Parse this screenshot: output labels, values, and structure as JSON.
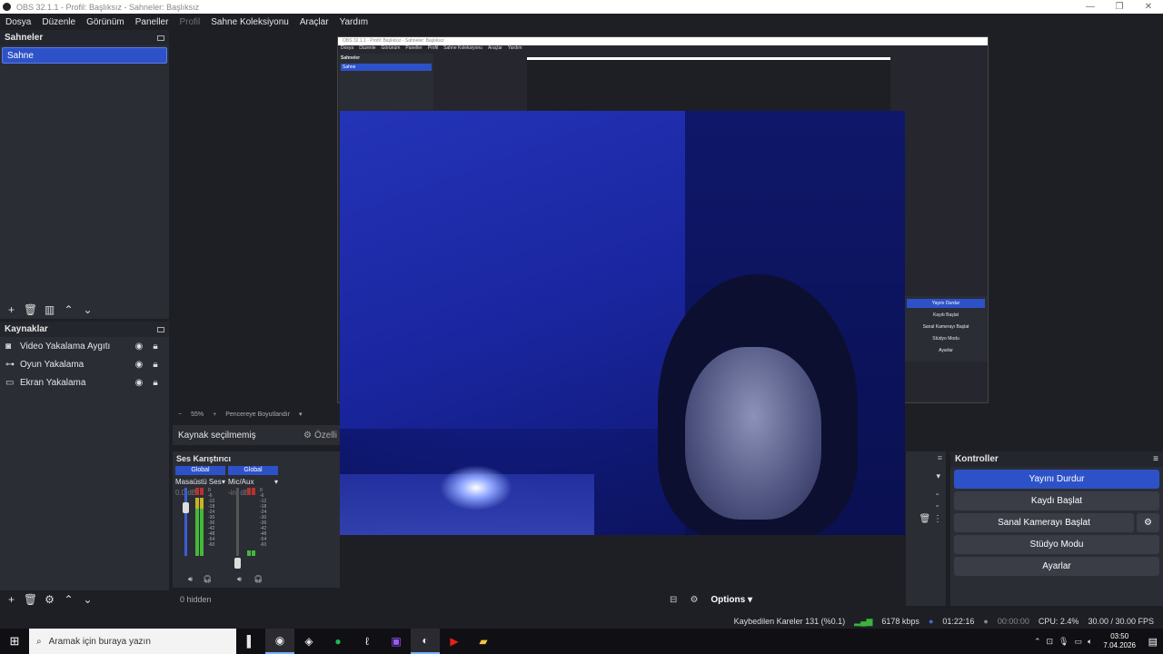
{
  "window": {
    "title": "OBS 32.1.1 - Profil: Başlıksız - Sahneler: Başlıksız",
    "controls": [
      "—",
      "❐",
      "✕"
    ]
  },
  "menu": [
    "Dosya",
    "Düzenle",
    "Görünüm",
    "Paneller",
    "Profil",
    "Sahne Koleksiyonu",
    "Araçlar",
    "Yardım"
  ],
  "scenes": {
    "title": "Sahneler",
    "items": [
      "Sahne"
    ]
  },
  "sources": {
    "title": "Kaynaklar",
    "items": [
      {
        "label": "Video Yakalama Aygıtı",
        "icon": "camera-icon"
      },
      {
        "label": "Oyun Yakalama",
        "icon": "gamepad-icon"
      },
      {
        "label": "Ekran Yakalama",
        "icon": "monitor-icon"
      }
    ]
  },
  "preview": {
    "zoom": "55%",
    "resize_label": "Pencereye Boyutlandır",
    "nested_title": "OBS 32.1.1 - Profil: Başlıksız - Sahneler: Başlıksız",
    "nested_menu": [
      "Dosya",
      "Düzenle",
      "Görünüm",
      "Paneller",
      "Profil",
      "Sahne Koleksiyonu",
      "Araçlar",
      "Yardım"
    ],
    "nested_scenes_title": "Sahneler",
    "nested_scene": "Sahne",
    "nested_controls": [
      "Yayını Durdur",
      "Kaydı Başlat",
      "Sanal Kamerayı Başlat",
      "Stüdyo Modu",
      "Ayarlar"
    ]
  },
  "properties": {
    "no_source": "Kaynak seçilmemiş",
    "props_label": "Özelli"
  },
  "mixer": {
    "title": "Ses Karıştırıcı",
    "channels": [
      {
        "global": "Global",
        "name": "Masaüstü Ses",
        "db": "0.0 dB",
        "level": 0.85
      },
      {
        "global": "Global",
        "name": "Mic/Aux",
        "db": "-inf dB",
        "level": 0.08
      }
    ],
    "scale": [
      "0",
      "-6",
      "-12",
      "-18",
      "-24",
      "-30",
      "-36",
      "-42",
      "-48",
      "-54",
      "-60"
    ]
  },
  "bottom": {
    "hidden": "0 hidden",
    "options": "Options"
  },
  "controls": {
    "title": "Kontroller",
    "stop_stream": "Yayını Durdur",
    "start_record": "Kaydı Başlat",
    "virtual_cam": "Sanal Kamerayı Başlat",
    "studio_mode": "Stüdyo Modu",
    "settings": "Ayarlar"
  },
  "status": {
    "dropped": "Kaybedilen Kareler 131 (%0.1)",
    "bitrate": "6178 kbps",
    "stream_time": "01:22:16",
    "record_time": "00:00:00",
    "cpu": "CPU: 2.4%",
    "fps": "30.00 / 30.00 FPS"
  },
  "taskbar": {
    "search_placeholder": "Aramak için buraya yazın",
    "time": "03:50",
    "date": "7.04.2026"
  },
  "colors": {
    "accent": "#2d52c8",
    "background": "#1e1f25",
    "panel": "#2b2d35"
  }
}
